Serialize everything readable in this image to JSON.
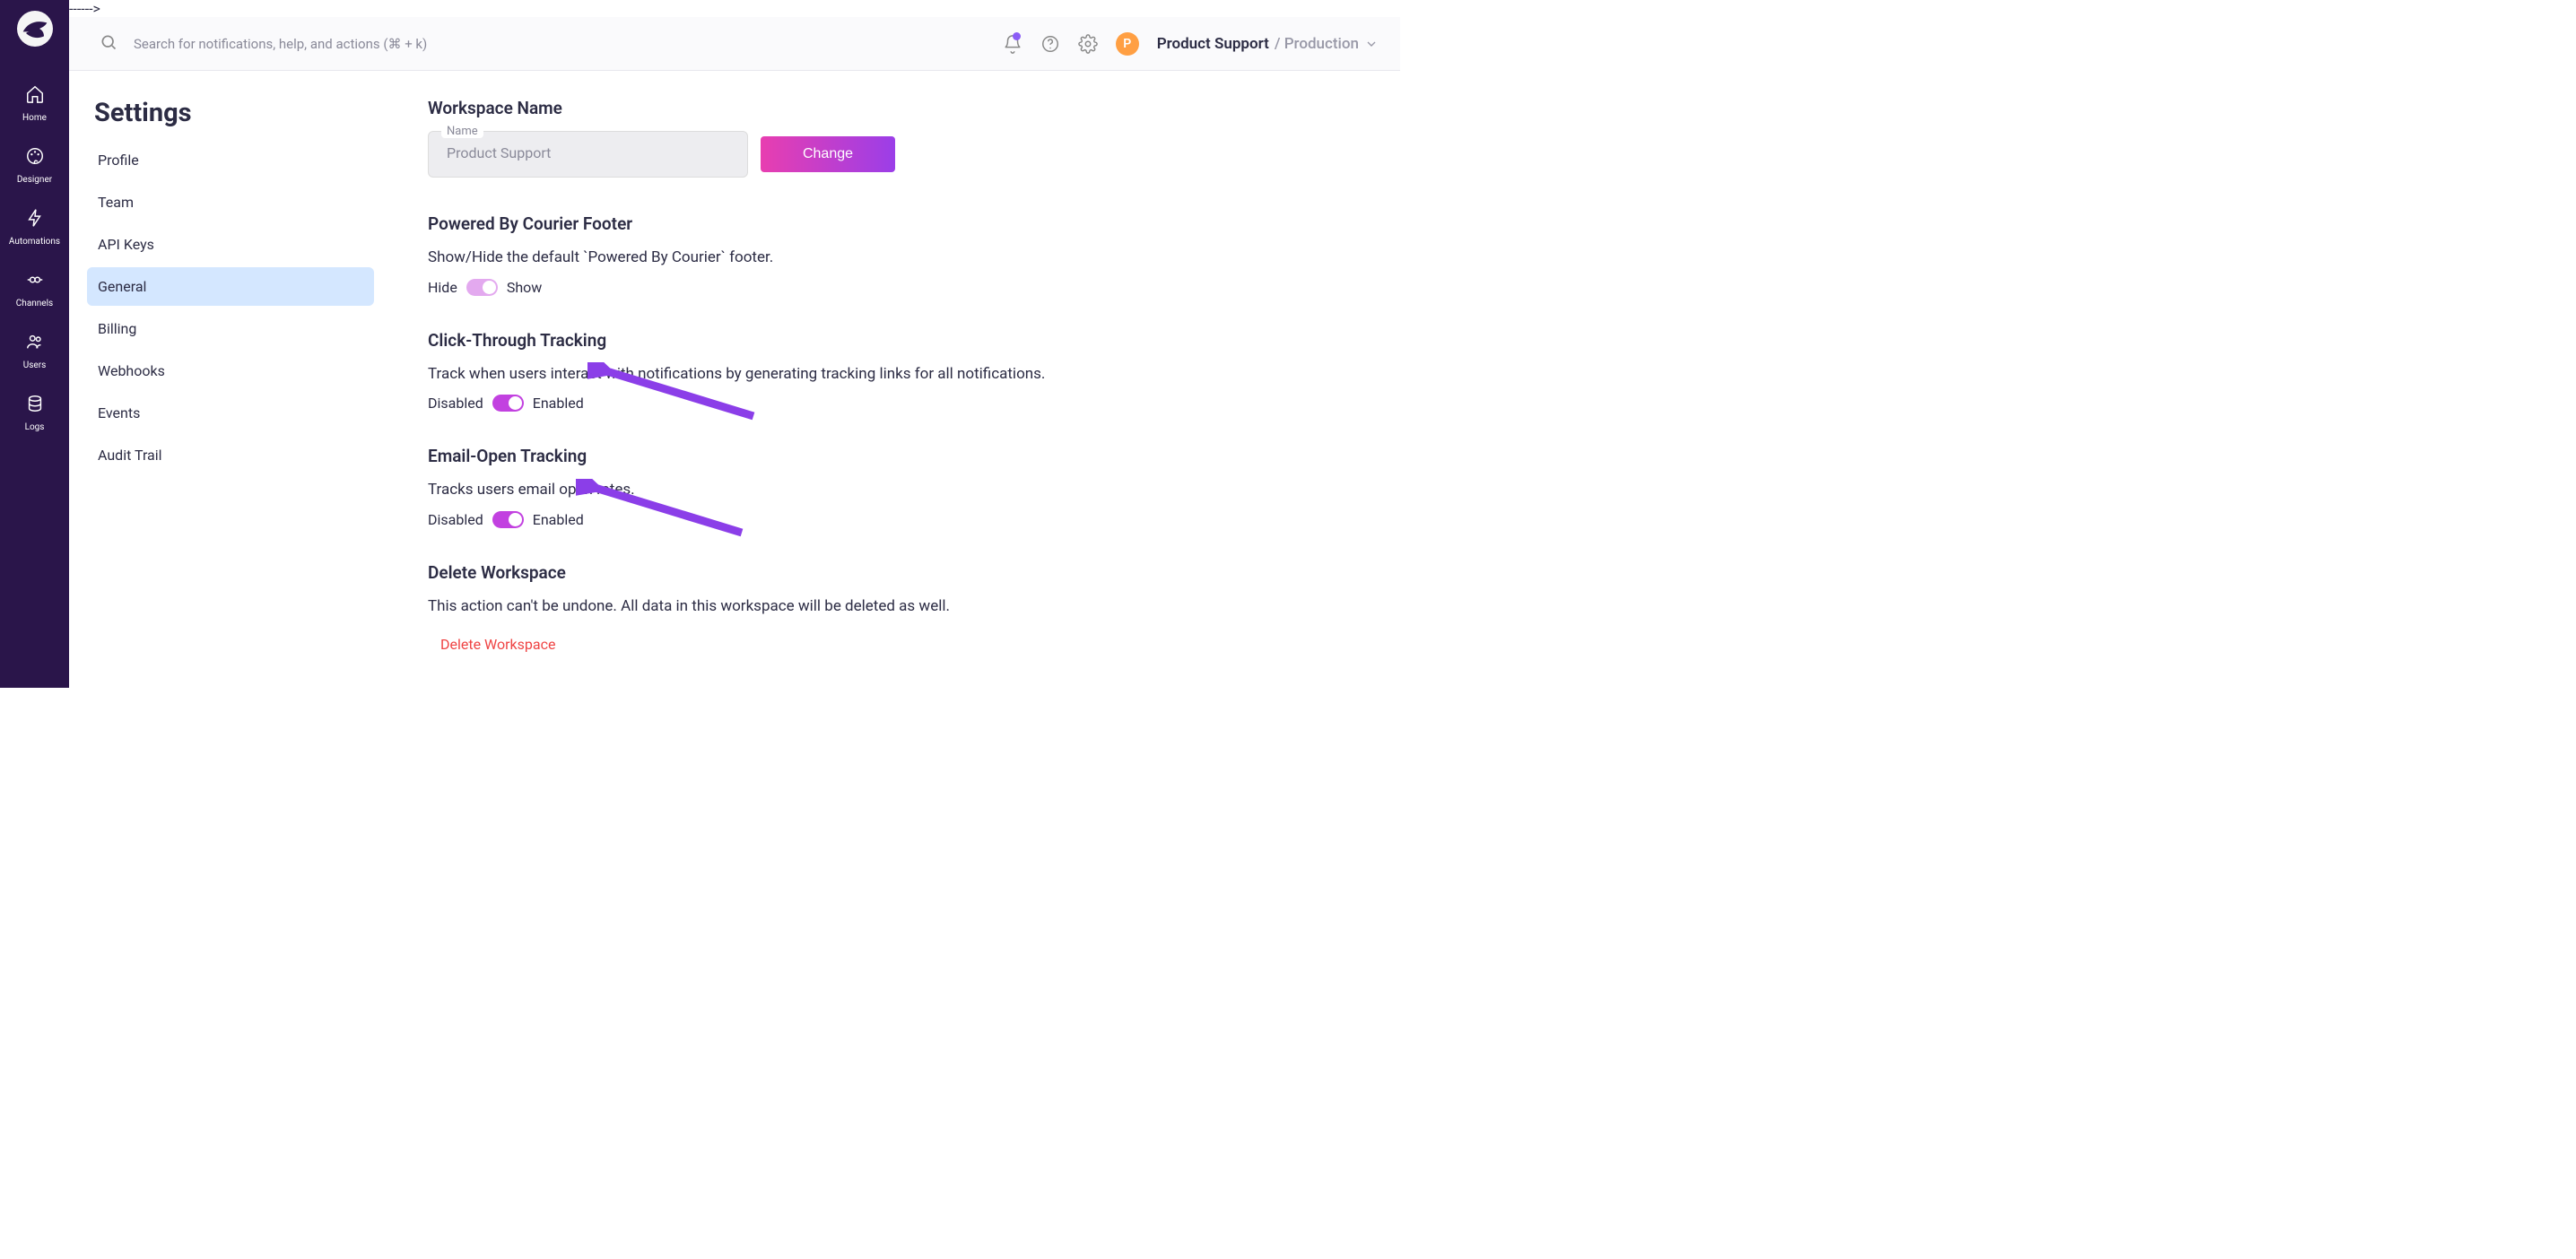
{
  "rail": {
    "items": [
      {
        "label": "Home"
      },
      {
        "label": "Designer"
      },
      {
        "label": "Automations"
      },
      {
        "label": "Channels"
      },
      {
        "label": "Users"
      },
      {
        "label": "Logs"
      }
    ]
  },
  "topbar": {
    "search_placeholder": "Search for notifications, help, and actions (⌘ + k)",
    "avatar_letter": "P",
    "workspace": "Product Support",
    "env_sep": " / ",
    "environment": "Production"
  },
  "settings": {
    "title": "Settings",
    "nav": [
      {
        "label": "Profile"
      },
      {
        "label": "Team"
      },
      {
        "label": "API Keys"
      },
      {
        "label": "General",
        "active": true
      },
      {
        "label": "Billing"
      },
      {
        "label": "Webhooks"
      },
      {
        "label": "Events"
      },
      {
        "label": "Audit Trail"
      }
    ]
  },
  "content": {
    "workspace_name": {
      "title": "Workspace Name",
      "field_label": "Name",
      "value": "Product Support",
      "button": "Change"
    },
    "powered_by": {
      "title": "Powered By Courier Footer",
      "desc": "Show/Hide the default `Powered By Courier` footer.",
      "left": "Hide",
      "right": "Show"
    },
    "click_through": {
      "title": "Click-Through Tracking",
      "desc": "Track when users interact with notifications by generating tracking links for all notifications.",
      "left": "Disabled",
      "right": "Enabled"
    },
    "email_open": {
      "title": "Email-Open Tracking",
      "desc": "Tracks users email open rates.",
      "left": "Disabled",
      "right": "Enabled"
    },
    "delete": {
      "title": "Delete Workspace",
      "desc": "This action can't be undone. All data in this workspace will be deleted as well.",
      "link": "Delete Workspace"
    }
  }
}
